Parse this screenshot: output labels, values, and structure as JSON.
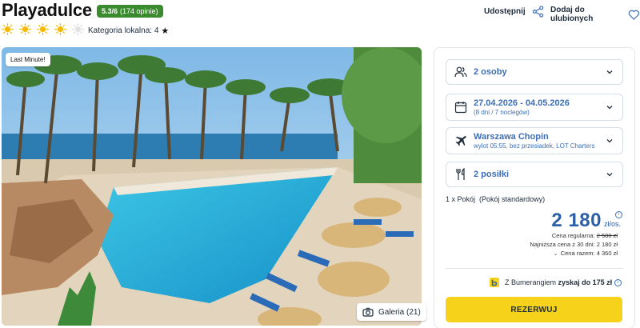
{
  "hotel": {
    "name": "Playadulce",
    "rating": "5.3/6",
    "reviews": "(174 opinie)",
    "suns": 4,
    "suns_total": 5,
    "local_category_label": "Kategoria lokalna: 4",
    "local_category_star": "★"
  },
  "actions": {
    "share_label": "Udostępnij",
    "favorite_label": "Dodaj do ulubionych"
  },
  "photo": {
    "badge": "Last Minute!",
    "gallery_label": "Galeria (21)"
  },
  "booking": {
    "persons": "2 osoby",
    "dates": "27.04.2026 - 04.05.2026",
    "duration": "(8 dni / 7 noclegów)",
    "departure": "Warszawa Chopin",
    "flight_info": "wylot 05:55, bez przesiadek, LOT Charters",
    "meals": "2 posiłki",
    "room_label": "1 x Pokój",
    "room_type": "(Pokój standardowy)",
    "price": "2 180",
    "price_unit": "zł/os.",
    "regular_price_label": "Cena regularna:",
    "regular_price": "2 580 zł",
    "lowest_30d": "Najniższa cena z 30 dni: 2 180 zł",
    "total_price": "Cena razem: 4 360 zł",
    "bumerang_prefix": "Z Bumerangiem",
    "bumerang_bold": "zyskaj do 175 zł",
    "book_label": "REZERWUJ"
  },
  "colors": {
    "accent": "#3d6fb6",
    "rating_badge": "#3a8a2e",
    "book_button": "#f6d31a",
    "sun": "#f5b800"
  }
}
